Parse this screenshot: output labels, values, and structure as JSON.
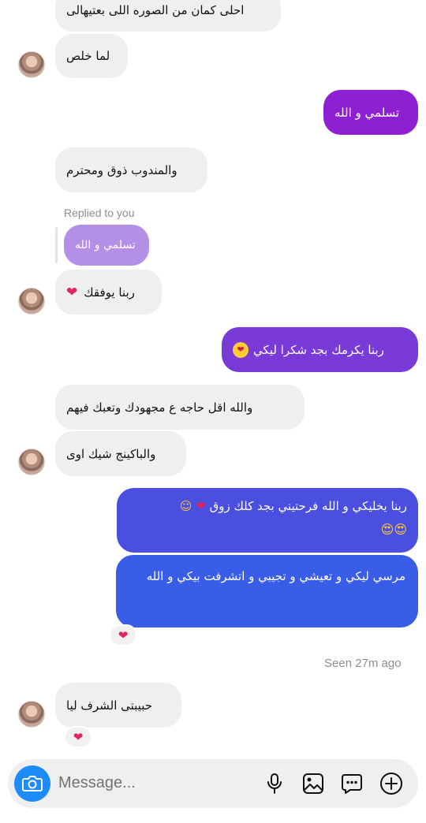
{
  "messages": {
    "m1": "احلى كمان من الصوره اللى بعتيهالى",
    "m2": "لما خلص",
    "m3": "تسلمي و الله",
    "m4": "والمندوب ذوق ومحترم",
    "replied_label": "Replied to you",
    "reply_quote": "تسلمي و الله",
    "m5": "ربنا يوفقك",
    "m6": "ربنا يكرمك بجد شكرا ليكي",
    "m7": "والله اقل حاجه ع مجهودك  وتعبك فيهم",
    "m8": "والباكينج شيك اوى",
    "m9_line1": "ربنا يخليكي و الله فرحتيني بجد كلك زوق",
    "m9_line2": "😍😍",
    "m10": "مرسي ليكي و تعيشي و تجيبي و اتشرفت بيكي و الله",
    "seen": "Seen 27m ago",
    "m11": "حبيبتى  الشرف ليا"
  },
  "reactions": {
    "heart": "❤"
  },
  "composer": {
    "placeholder": "Message..."
  },
  "colors": {
    "incoming_bg": "#efefef",
    "out_purple": "#8e1fd3",
    "out_violet": "#7a3ad8",
    "out_indigo": "#4b4fe0",
    "out_blue": "#3a5de8",
    "reply_lavender": "#b48fe6",
    "camera_blue": "#1d8cf8"
  },
  "icons": [
    "camera-icon",
    "microphone-icon",
    "image-icon",
    "sticker-icon",
    "add-icon"
  ]
}
